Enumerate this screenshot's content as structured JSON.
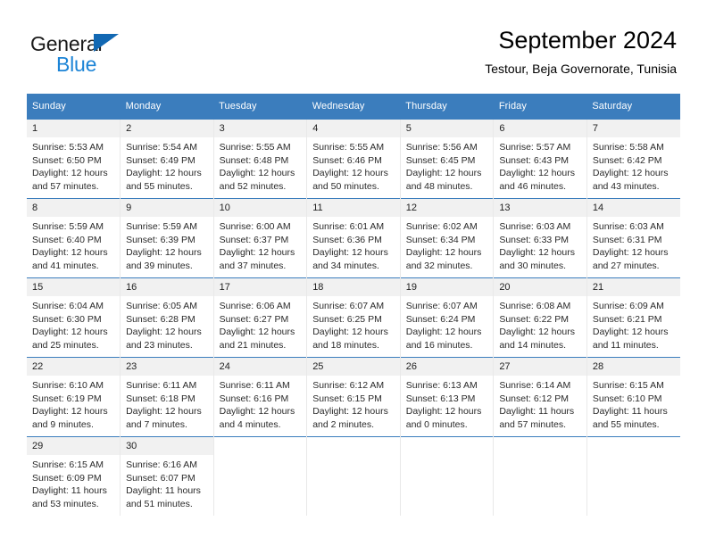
{
  "brand": {
    "name_primary": "General",
    "name_secondary": "Blue"
  },
  "header": {
    "title": "September 2024",
    "subtitle": "Testour, Beja Governorate, Tunisia"
  },
  "colors": {
    "header_blue": "#3b7dbd",
    "logo_blue": "#1c84d6",
    "daynum_background": "#f1f1f1"
  },
  "weekday_headers": [
    "Sunday",
    "Monday",
    "Tuesday",
    "Wednesday",
    "Thursday",
    "Friday",
    "Saturday"
  ],
  "weeks": [
    [
      {
        "day": "1",
        "sunrise": "Sunrise: 5:53 AM",
        "sunset": "Sunset: 6:50 PM",
        "daylight_1": "Daylight: 12 hours",
        "daylight_2": "and 57 minutes."
      },
      {
        "day": "2",
        "sunrise": "Sunrise: 5:54 AM",
        "sunset": "Sunset: 6:49 PM",
        "daylight_1": "Daylight: 12 hours",
        "daylight_2": "and 55 minutes."
      },
      {
        "day": "3",
        "sunrise": "Sunrise: 5:55 AM",
        "sunset": "Sunset: 6:48 PM",
        "daylight_1": "Daylight: 12 hours",
        "daylight_2": "and 52 minutes."
      },
      {
        "day": "4",
        "sunrise": "Sunrise: 5:55 AM",
        "sunset": "Sunset: 6:46 PM",
        "daylight_1": "Daylight: 12 hours",
        "daylight_2": "and 50 minutes."
      },
      {
        "day": "5",
        "sunrise": "Sunrise: 5:56 AM",
        "sunset": "Sunset: 6:45 PM",
        "daylight_1": "Daylight: 12 hours",
        "daylight_2": "and 48 minutes."
      },
      {
        "day": "6",
        "sunrise": "Sunrise: 5:57 AM",
        "sunset": "Sunset: 6:43 PM",
        "daylight_1": "Daylight: 12 hours",
        "daylight_2": "and 46 minutes."
      },
      {
        "day": "7",
        "sunrise": "Sunrise: 5:58 AM",
        "sunset": "Sunset: 6:42 PM",
        "daylight_1": "Daylight: 12 hours",
        "daylight_2": "and 43 minutes."
      }
    ],
    [
      {
        "day": "8",
        "sunrise": "Sunrise: 5:59 AM",
        "sunset": "Sunset: 6:40 PM",
        "daylight_1": "Daylight: 12 hours",
        "daylight_2": "and 41 minutes."
      },
      {
        "day": "9",
        "sunrise": "Sunrise: 5:59 AM",
        "sunset": "Sunset: 6:39 PM",
        "daylight_1": "Daylight: 12 hours",
        "daylight_2": "and 39 minutes."
      },
      {
        "day": "10",
        "sunrise": "Sunrise: 6:00 AM",
        "sunset": "Sunset: 6:37 PM",
        "daylight_1": "Daylight: 12 hours",
        "daylight_2": "and 37 minutes."
      },
      {
        "day": "11",
        "sunrise": "Sunrise: 6:01 AM",
        "sunset": "Sunset: 6:36 PM",
        "daylight_1": "Daylight: 12 hours",
        "daylight_2": "and 34 minutes."
      },
      {
        "day": "12",
        "sunrise": "Sunrise: 6:02 AM",
        "sunset": "Sunset: 6:34 PM",
        "daylight_1": "Daylight: 12 hours",
        "daylight_2": "and 32 minutes."
      },
      {
        "day": "13",
        "sunrise": "Sunrise: 6:03 AM",
        "sunset": "Sunset: 6:33 PM",
        "daylight_1": "Daylight: 12 hours",
        "daylight_2": "and 30 minutes."
      },
      {
        "day": "14",
        "sunrise": "Sunrise: 6:03 AM",
        "sunset": "Sunset: 6:31 PM",
        "daylight_1": "Daylight: 12 hours",
        "daylight_2": "and 27 minutes."
      }
    ],
    [
      {
        "day": "15",
        "sunrise": "Sunrise: 6:04 AM",
        "sunset": "Sunset: 6:30 PM",
        "daylight_1": "Daylight: 12 hours",
        "daylight_2": "and 25 minutes."
      },
      {
        "day": "16",
        "sunrise": "Sunrise: 6:05 AM",
        "sunset": "Sunset: 6:28 PM",
        "daylight_1": "Daylight: 12 hours",
        "daylight_2": "and 23 minutes."
      },
      {
        "day": "17",
        "sunrise": "Sunrise: 6:06 AM",
        "sunset": "Sunset: 6:27 PM",
        "daylight_1": "Daylight: 12 hours",
        "daylight_2": "and 21 minutes."
      },
      {
        "day": "18",
        "sunrise": "Sunrise: 6:07 AM",
        "sunset": "Sunset: 6:25 PM",
        "daylight_1": "Daylight: 12 hours",
        "daylight_2": "and 18 minutes."
      },
      {
        "day": "19",
        "sunrise": "Sunrise: 6:07 AM",
        "sunset": "Sunset: 6:24 PM",
        "daylight_1": "Daylight: 12 hours",
        "daylight_2": "and 16 minutes."
      },
      {
        "day": "20",
        "sunrise": "Sunrise: 6:08 AM",
        "sunset": "Sunset: 6:22 PM",
        "daylight_1": "Daylight: 12 hours",
        "daylight_2": "and 14 minutes."
      },
      {
        "day": "21",
        "sunrise": "Sunrise: 6:09 AM",
        "sunset": "Sunset: 6:21 PM",
        "daylight_1": "Daylight: 12 hours",
        "daylight_2": "and 11 minutes."
      }
    ],
    [
      {
        "day": "22",
        "sunrise": "Sunrise: 6:10 AM",
        "sunset": "Sunset: 6:19 PM",
        "daylight_1": "Daylight: 12 hours",
        "daylight_2": "and 9 minutes."
      },
      {
        "day": "23",
        "sunrise": "Sunrise: 6:11 AM",
        "sunset": "Sunset: 6:18 PM",
        "daylight_1": "Daylight: 12 hours",
        "daylight_2": "and 7 minutes."
      },
      {
        "day": "24",
        "sunrise": "Sunrise: 6:11 AM",
        "sunset": "Sunset: 6:16 PM",
        "daylight_1": "Daylight: 12 hours",
        "daylight_2": "and 4 minutes."
      },
      {
        "day": "25",
        "sunrise": "Sunrise: 6:12 AM",
        "sunset": "Sunset: 6:15 PM",
        "daylight_1": "Daylight: 12 hours",
        "daylight_2": "and 2 minutes."
      },
      {
        "day": "26",
        "sunrise": "Sunrise: 6:13 AM",
        "sunset": "Sunset: 6:13 PM",
        "daylight_1": "Daylight: 12 hours",
        "daylight_2": "and 0 minutes."
      },
      {
        "day": "27",
        "sunrise": "Sunrise: 6:14 AM",
        "sunset": "Sunset: 6:12 PM",
        "daylight_1": "Daylight: 11 hours",
        "daylight_2": "and 57 minutes."
      },
      {
        "day": "28",
        "sunrise": "Sunrise: 6:15 AM",
        "sunset": "Sunset: 6:10 PM",
        "daylight_1": "Daylight: 11 hours",
        "daylight_2": "and 55 minutes."
      }
    ],
    [
      {
        "day": "29",
        "sunrise": "Sunrise: 6:15 AM",
        "sunset": "Sunset: 6:09 PM",
        "daylight_1": "Daylight: 11 hours",
        "daylight_2": "and 53 minutes."
      },
      {
        "day": "30",
        "sunrise": "Sunrise: 6:16 AM",
        "sunset": "Sunset: 6:07 PM",
        "daylight_1": "Daylight: 11 hours",
        "daylight_2": "and 51 minutes."
      },
      {
        "day": "",
        "sunrise": "",
        "sunset": "",
        "daylight_1": "",
        "daylight_2": ""
      },
      {
        "day": "",
        "sunrise": "",
        "sunset": "",
        "daylight_1": "",
        "daylight_2": ""
      },
      {
        "day": "",
        "sunrise": "",
        "sunset": "",
        "daylight_1": "",
        "daylight_2": ""
      },
      {
        "day": "",
        "sunrise": "",
        "sunset": "",
        "daylight_1": "",
        "daylight_2": ""
      },
      {
        "day": "",
        "sunrise": "",
        "sunset": "",
        "daylight_1": "",
        "daylight_2": ""
      }
    ]
  ]
}
